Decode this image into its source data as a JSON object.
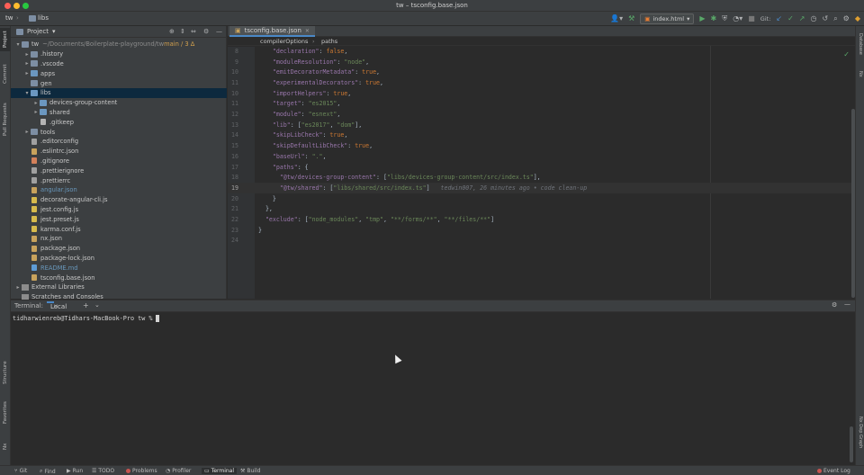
{
  "window": {
    "title": "tw – tsconfig.base.json"
  },
  "colors": {
    "close": "#ff5f57",
    "minimize": "#febc2e",
    "maximize": "#28c840",
    "accent": "#4a88c7",
    "selection": "#0d293e"
  },
  "navbar": {
    "crumbs": [
      "tw",
      "libs"
    ],
    "run_config": "index.html",
    "git_label": "Git:"
  },
  "left_tabs": [
    "Project",
    "Commit",
    "Pull Requests",
    "Structure",
    "Favorites",
    "Nx"
  ],
  "right_tabs": [
    "Database",
    "Nx",
    "Nx Dep Graph"
  ],
  "project": {
    "header": "Project",
    "tree": [
      {
        "label": "tw",
        "extra": "~/Documents/Boilerplate-playground/tw",
        "branch": "main / 3 ∆",
        "depth": 0,
        "kind": "folder",
        "expanded": true
      },
      {
        "label": ".history",
        "depth": 1,
        "kind": "folder",
        "expanded": false
      },
      {
        "label": ".vscode",
        "depth": 1,
        "kind": "folder",
        "expanded": false
      },
      {
        "label": "apps",
        "depth": 1,
        "kind": "folder-mod",
        "expanded": false
      },
      {
        "label": "gen",
        "depth": 1,
        "kind": "folder",
        "expanded": null
      },
      {
        "label": "libs",
        "depth": 1,
        "kind": "folder-mod",
        "expanded": true,
        "selected": true
      },
      {
        "label": "devices-group-content",
        "depth": 2,
        "kind": "folder-mod",
        "expanded": false
      },
      {
        "label": "shared",
        "depth": 2,
        "kind": "folder-mod",
        "expanded": false
      },
      {
        "label": ".gitkeep",
        "depth": 2,
        "kind": "file"
      },
      {
        "label": "tools",
        "depth": 1,
        "kind": "folder",
        "expanded": false
      },
      {
        "label": ".editorconfig",
        "depth": 1,
        "kind": "cfg"
      },
      {
        "label": ".eslintrc.json",
        "depth": 1,
        "kind": "json"
      },
      {
        "label": ".gitignore",
        "depth": 1,
        "kind": "git"
      },
      {
        "label": ".prettierignore",
        "depth": 1,
        "kind": "cfg"
      },
      {
        "label": ".prettierrc",
        "depth": 1,
        "kind": "cfg"
      },
      {
        "label": "angular.json",
        "depth": 1,
        "kind": "json",
        "modified": true
      },
      {
        "label": "decorate-angular-cli.js",
        "depth": 1,
        "kind": "js"
      },
      {
        "label": "jest.config.js",
        "depth": 1,
        "kind": "js"
      },
      {
        "label": "jest.preset.js",
        "depth": 1,
        "kind": "js"
      },
      {
        "label": "karma.conf.js",
        "depth": 1,
        "kind": "js"
      },
      {
        "label": "nx.json",
        "depth": 1,
        "kind": "json"
      },
      {
        "label": "package.json",
        "depth": 1,
        "kind": "json"
      },
      {
        "label": "package-lock.json",
        "depth": 1,
        "kind": "json"
      },
      {
        "label": "README.md",
        "depth": 1,
        "kind": "md",
        "modified": true
      },
      {
        "label": "tsconfig.base.json",
        "depth": 1,
        "kind": "json"
      },
      {
        "label": "External Libraries",
        "depth": 0,
        "kind": "lib",
        "expanded": false
      },
      {
        "label": "Scratches and Consoles",
        "depth": 0,
        "kind": "lib",
        "expanded": null
      }
    ]
  },
  "editor": {
    "tab": "tsconfig.base.json",
    "breadcrumb": [
      "compilerOptions",
      "paths"
    ],
    "lines": [
      {
        "n": "8",
        "html": "    <span class='k'>\"declaration\"</span>: <span class='kw'>false</span>,"
      },
      {
        "n": "9",
        "html": "    <span class='k'>\"moduleResolution\"</span>: <span class='s'>\"node\"</span>,"
      },
      {
        "n": "10",
        "html": "    <span class='k'>\"emitDecoratorMetadata\"</span>: <span class='kw'>true</span>,"
      },
      {
        "n": "11",
        "html": "    <span class='k'>\"experimentalDecorators\"</span>: <span class='kw'>true</span>,"
      },
      {
        "n": "10",
        "html": "    <span class='k'>\"importHelpers\"</span>: <span class='kw'>true</span>,"
      },
      {
        "n": "11",
        "html": "    <span class='k'>\"target\"</span>: <span class='s'>\"es2015\"</span>,"
      },
      {
        "n": "12",
        "html": "    <span class='k'>\"module\"</span>: <span class='s'>\"esnext\"</span>,"
      },
      {
        "n": "13",
        "html": "    <span class='k'>\"lib\"</span>: [<span class='s'>\"es2017\"</span>, <span class='s'>\"dom\"</span>],"
      },
      {
        "n": "14",
        "html": "    <span class='k'>\"skipLibCheck\"</span>: <span class='kw'>true</span>,"
      },
      {
        "n": "15",
        "html": "    <span class='k'>\"skipDefaultLibCheck\"</span>: <span class='kw'>true</span>,"
      },
      {
        "n": "16",
        "html": "    <span class='k'>\"baseUrl\"</span>: <span class='s'>\".\"</span>,"
      },
      {
        "n": "17",
        "html": "    <span class='k'>\"paths\"</span>: {"
      },
      {
        "n": "18",
        "html": "      <span class='k'>\"@tw/devices-group-content\"</span>: [<span class='s'>\"libs/devices-group-content/src/index.ts\"</span>],"
      },
      {
        "n": "19",
        "html": "      <span class='k'>\"@tw/shared\"</span>: [<span class='s'>\"libs/shared/src/index.ts\"</span>]   <span class='blame'>tedwin007, 26 minutes ago • code clean-up</span>",
        "current": true
      },
      {
        "n": "20",
        "html": "    }"
      },
      {
        "n": "21",
        "html": "  },"
      },
      {
        "n": "22",
        "html": "  <span class='k'>\"exclude\"</span>: [<span class='s'>\"node_modules\"</span>, <span class='s'>\"tmp\"</span>, <span class='s'>\"**/forms/**\"</span>, <span class='s'>\"**/files/**\"</span>]"
      },
      {
        "n": "23",
        "html": "}"
      },
      {
        "n": "24",
        "html": ""
      }
    ]
  },
  "terminal": {
    "label": "Terminal:",
    "tab": "Local",
    "prompt": "tidharwienreb@Tidhars-MacBook-Pro tw %"
  },
  "statusbar": {
    "items": [
      "Git",
      "Find",
      "Run",
      "TODO",
      "Problems",
      "Profiler",
      "Terminal",
      "Build"
    ],
    "active": "Terminal",
    "event_log": "Event Log"
  }
}
